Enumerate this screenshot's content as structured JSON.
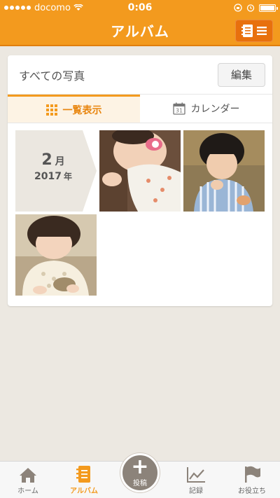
{
  "status": {
    "carrier": "docomo",
    "time": "0:06"
  },
  "nav": {
    "title": "アルバム",
    "menu_icon": "album-list-icon"
  },
  "album": {
    "header_title": "すべての写真",
    "edit_label": "編集",
    "tabs": [
      {
        "label": "一覧表示",
        "icon": "grid-icon",
        "active": true
      },
      {
        "label": "カレンダー",
        "icon": "calendar-icon",
        "calendar_day": "31",
        "active": false
      }
    ],
    "month_group": {
      "month": "2",
      "month_unit": "月",
      "year": "2017",
      "year_unit": "年"
    },
    "photo_count": 3
  },
  "tabbar": {
    "items": [
      {
        "label": "ホーム",
        "icon": "home-icon",
        "active": false
      },
      {
        "label": "アルバム",
        "icon": "album-icon",
        "active": true
      },
      {
        "label": "記録",
        "icon": "chart-icon",
        "active": false
      },
      {
        "label": "お役立ち",
        "icon": "flag-icon",
        "active": false
      }
    ],
    "post_label": "投稿"
  },
  "colors": {
    "accent": "#f39a1e",
    "background": "#ece8e1",
    "active_tab_bg": "#fdf3e4"
  }
}
